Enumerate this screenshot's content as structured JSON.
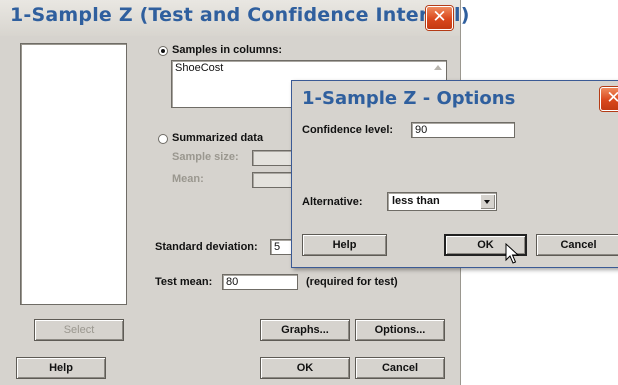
{
  "main": {
    "title": "1-Sample Z (Test and Confidence Interval)",
    "close_glyph": "✕",
    "samples_in_columns_label": "Samples in columns:",
    "samples_value": "ShoeCost",
    "summarized_label": "Summarized data",
    "sample_size_label": "Sample size:",
    "mean_label": "Mean:",
    "std_dev_label": "Standard deviation:",
    "std_dev_value": "5",
    "test_mean_label": "Test mean:",
    "test_mean_value": "80",
    "required_note": "(required for test)",
    "buttons": {
      "select": "Select",
      "graphs": "Graphs...",
      "options": "Options...",
      "help": "Help",
      "ok": "OK",
      "cancel": "Cancel"
    }
  },
  "options_dialog": {
    "title": "1-Sample Z - Options",
    "confidence_label": "Confidence level:",
    "confidence_value": "90",
    "alternative_label": "Alternative:",
    "alternative_value": "less than",
    "buttons": {
      "help": "Help",
      "ok": "OK",
      "cancel": "Cancel"
    }
  },
  "colors": {
    "title_text": "#2f5f9e",
    "close_button": "#d9481d",
    "dialog_face": "#d6d3ce"
  },
  "icons": [
    "close-icon",
    "radio-selected-icon",
    "radio-unselected-icon",
    "scroll-up-arrow-icon",
    "dropdown-arrow-icon",
    "mouse-cursor-icon"
  ]
}
